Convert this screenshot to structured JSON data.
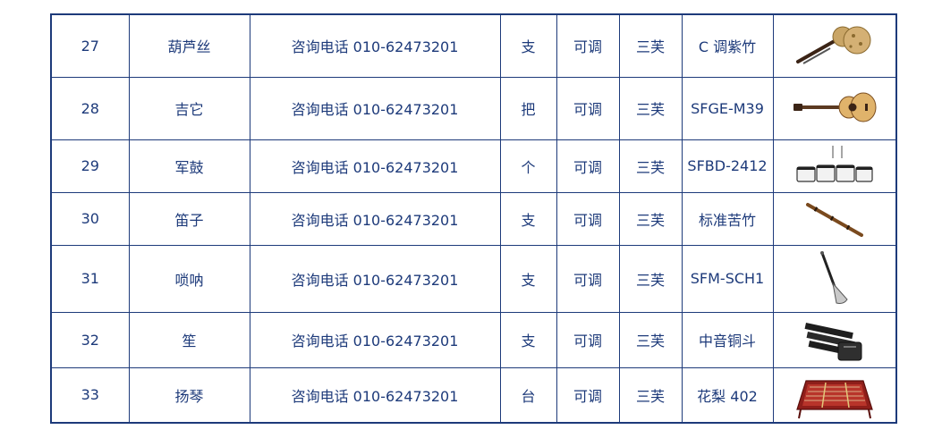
{
  "rows": [
    {
      "no": "27",
      "name": "葫芦丝",
      "price": "咨询电话 010-62473201",
      "unit": "支",
      "tone": "可调",
      "brand": "三芙",
      "model": "C 调紫竹",
      "image": "hulusi-image"
    },
    {
      "no": "28",
      "name": "吉它",
      "price": "咨询电话 010-62473201",
      "unit": "把",
      "tone": "可调",
      "brand": "三芙",
      "model": "SFGE-M39",
      "image": "guitar-image"
    },
    {
      "no": "29",
      "name": "军鼓",
      "price": "咨询电话 010-62473201",
      "unit": "个",
      "tone": "可调",
      "brand": "三芙",
      "model": "SFBD-2412",
      "image": "marching-drums-image"
    },
    {
      "no": "30",
      "name": "笛子",
      "price": "咨询电话 010-62473201",
      "unit": "支",
      "tone": "可调",
      "brand": "三芙",
      "model": "标准苦竹",
      "image": "dizi-flute-image"
    },
    {
      "no": "31",
      "name": "唢呐",
      "price": "咨询电话 010-62473201",
      "unit": "支",
      "tone": "可调",
      "brand": "三芙",
      "model": "SFM-SCH1",
      "image": "suona-image"
    },
    {
      "no": "32",
      "name": "笙",
      "price": "咨询电话 010-62473201",
      "unit": "支",
      "tone": "可调",
      "brand": "三芙",
      "model": "中音铜斗",
      "image": "sheng-image"
    },
    {
      "no": "33",
      "name": "扬琴",
      "price": "咨询电话 010-62473201",
      "unit": "台",
      "tone": "可调",
      "brand": "三芙",
      "model": "花梨 402",
      "image": "yangqin-image"
    }
  ],
  "colors": {
    "text": "#1d3a7a",
    "border": "#1d3a7a"
  }
}
